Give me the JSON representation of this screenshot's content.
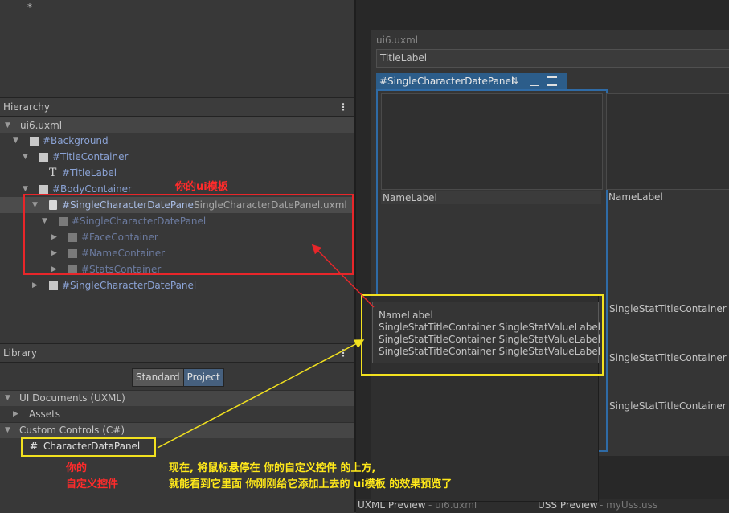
{
  "top": {
    "asterisk": "*"
  },
  "hierarchy": {
    "title": "Hierarchy",
    "menu": "⋮",
    "root": "ui6.uxml",
    "rows": [
      "#Background",
      "#TitleContainer",
      "#TitleLabel",
      "#BodyContainer",
      "#SingleCharacterDatePanel",
      "SingleCharacterDatePanel.uxml",
      "#SingleCharacterDatePanel",
      "#FaceContainer",
      "#NameContainer",
      "#StatsContainer",
      "#SingleCharacterDatePanel"
    ],
    "text_icon": "T"
  },
  "library": {
    "title": "Library",
    "menu": "⋮",
    "tab_standard": "Standard",
    "tab_project": "Project",
    "group_uxml": "UI Documents (UXML)",
    "assets": "Assets",
    "group_custom": "Custom Controls (C#)",
    "control": "CharacterDataPanel",
    "control_icon": "#"
  },
  "canvas": {
    "doc": "ui6.uxml",
    "title_label": "TitleLabel",
    "selected_panel": "#SingleCharacterDatePanel",
    "name_label_1": "NameLabel",
    "name_label_2": "NameLabel",
    "stat_1": "SingleStatTitleContainer",
    "stat_2": "SingleStatTitleContainer",
    "stat_3": "SingleStatTitleContainer",
    "uxml_preview": "UXML Preview",
    "uxml_preview_file": "- ui6.uxml",
    "uss_preview": "USS Preview",
    "uss_preview_file": "- myUss.uss"
  },
  "tooltip": {
    "line1": "NameLabel",
    "line2": "SingleStatTitleContainer SingleStatValueLabel",
    "line3": "SingleStatTitleContainer SingleStatValueLabel",
    "line4": "SingleStatTitleContainer SingleStatValueLabel"
  },
  "annotations": {
    "template_note": "你的ui模板",
    "control_note_1": "你的",
    "control_note_2": "自定义控件",
    "explain_1": "现在, 将鼠标悬停在 你的自定义控件 的上方,",
    "explain_2": "就能看到它里面 你刚刚给它添加上去的 ui模板 的效果预览了"
  },
  "colors": {
    "annotation_red": "#ff2b2b",
    "annotation_yellow": "#ffe81a",
    "selection_blue": "#2c5d8a",
    "element_blue": "#8ba3d6"
  }
}
